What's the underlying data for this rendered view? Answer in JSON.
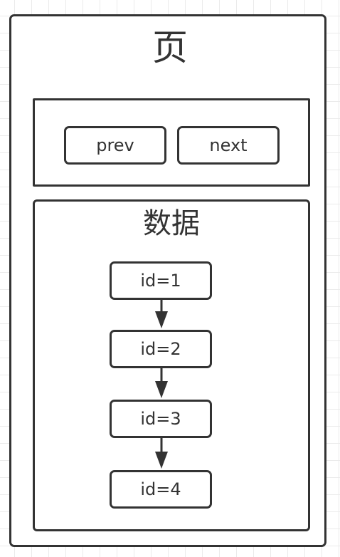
{
  "page": {
    "title": "页"
  },
  "nav": {
    "prev_label": "prev",
    "next_label": "next"
  },
  "data_panel": {
    "title": "数据",
    "nodes": [
      "id=1",
      "id=2",
      "id=3",
      "id=4"
    ]
  },
  "colors": {
    "stroke": "#333333",
    "background": "#ffffff",
    "grid": "#ebebeb"
  }
}
